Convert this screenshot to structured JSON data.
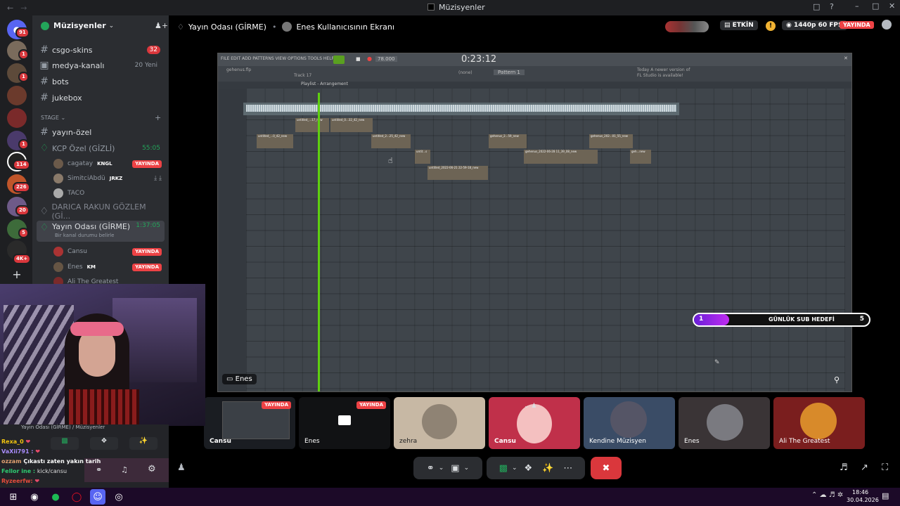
{
  "window": {
    "title": "Müzisyenler"
  },
  "server": {
    "name": "Müzisyenler"
  },
  "rail_badges": [
    "91",
    "1",
    "1",
    "1",
    "1",
    "114",
    "226",
    "20",
    "5",
    "4K+"
  ],
  "channels": [
    {
      "name": "csgo-skins",
      "badge": "32",
      "type": "text"
    },
    {
      "name": "medya-kanalı",
      "badge": "20 Yeni",
      "type": "forum"
    },
    {
      "name": "bots",
      "badge": "",
      "type": "text"
    },
    {
      "name": "jukebox",
      "badge": "",
      "type": "text"
    }
  ],
  "stage_label": "STAGE",
  "stage_channel": "yayın-özel",
  "kcp": {
    "name": "KCP Özel (GİZLİ)",
    "time": "55:05"
  },
  "kcp_users": [
    {
      "name": "cagatay",
      "tag": "KNGL",
      "live": "YAYINDA"
    },
    {
      "name": "SimitciAbdü",
      "tag": "JRKZ",
      "live": ""
    },
    {
      "name": "TACO",
      "tag": "",
      "live": ""
    }
  ],
  "darica": "DARICA RAKUN GÖZLEM (Gİ...",
  "yayin": {
    "name": "Yayın Odası (GİRME)",
    "time": "1:37:05",
    "status": "Bir kanal durumu belirle"
  },
  "yayin_users": [
    {
      "name": "Cansu",
      "tag": "",
      "live": "YAYINDA"
    },
    {
      "name": "Enes",
      "tag": "KM",
      "live": "YAYINDA"
    },
    {
      "name": "Ali The Greatest",
      "tag": "",
      "live": ""
    }
  ],
  "header": {
    "channel": "Yayın Odası (GİRME)",
    "screen": "Enes Kullanıcısının Ekranı",
    "active": "ETKİN",
    "quality": "1440p 60 FPS",
    "live": "YAYINDA"
  },
  "fl": {
    "menu": "FILE EDIT ADD PATTERNS VIEW OPTIONS TOOLS HELP",
    "time": "0:23:12",
    "tempo": "78.000",
    "pattern": "Pattern 1",
    "playlist": "Playlist - Arrangement",
    "none": "(none)",
    "file": "gehenus.flp",
    "track": "Track 17",
    "news1": "Today  A newer version of",
    "news2": "FL Studio is available!"
  },
  "clips": [
    "untitled_...0_42_new",
    "untitled_...17_new",
    "untitled_0...32_42_new",
    "untitled_2...25_42_new",
    "gehenus_2...59_new",
    "gehenus_2022-06-28 11_39_08_new",
    "gehenus_202...01_55_new",
    "untit...s",
    "untitled_2022-06-21 22-59-18_new",
    "geh...new"
  ],
  "sub_goal": {
    "current": "1",
    "label": "GÜNLÜK SUB HEDEFİ",
    "target": "5",
    "progress": 0.2
  },
  "stream_label": "Enes",
  "tiles": [
    {
      "name": "Cansu",
      "live": "YAYINDA"
    },
    {
      "name": "Enes",
      "live": "YAYINDA"
    },
    {
      "name": "zehra",
      "live": ""
    },
    {
      "name": "Cansu",
      "live": ""
    },
    {
      "name": "Kendine Müzisyen",
      "live": ""
    },
    {
      "name": "Enes",
      "live": ""
    },
    {
      "name": "Ali The Greatest",
      "live": ""
    }
  ],
  "voice_bar": {
    "channel": "Yayın Odası (GİRME) / Müzisyenler"
  },
  "chat": [
    {
      "user": "Rexa_0",
      "msg": "",
      "color": "#f1c40f"
    },
    {
      "user": "VaXii791 :",
      "msg": "",
      "color": "#a78bfa"
    },
    {
      "user": "ozzam",
      "msg": "Çıkastı zaten yakın tarih",
      "color": "#e0e0e0"
    },
    {
      "user": "Fellor ine :",
      "msg": "kick/cansu",
      "color": "#2ecc71"
    },
    {
      "user": "Ryzeerfw:",
      "msg": "",
      "color": "#e74c3c"
    }
  ],
  "clock": {
    "time": "18:46",
    "date": "30.04.2026"
  }
}
